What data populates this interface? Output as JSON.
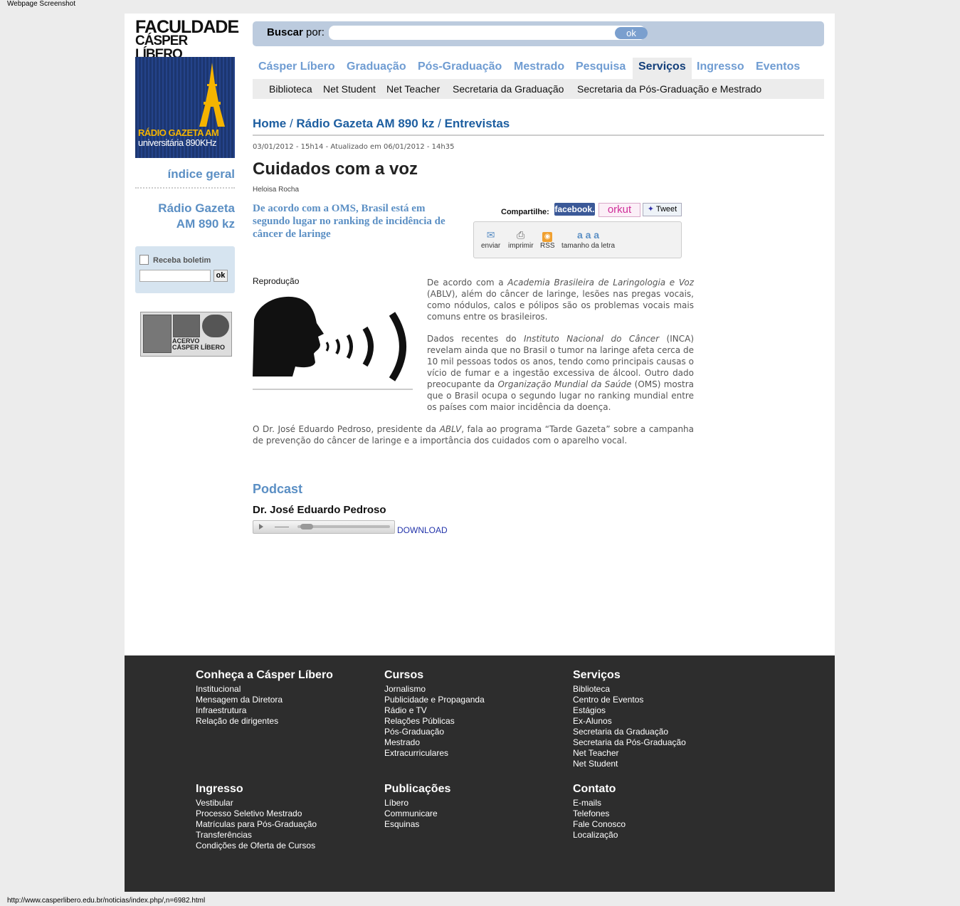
{
  "caption_top": "Webpage Screenshot",
  "caption_bottom": "http://www.casperlibero.edu.br/noticias/index.php/,n=6982.html",
  "logo": {
    "line1": "FACULDADE",
    "line2": "CÁSPER LÍBERO"
  },
  "radio_banner": {
    "line1": "RÁDIO GAZETA AM",
    "line2": "universitária 890KHz"
  },
  "sidebar": {
    "indice": "índice geral",
    "radio_line1": "Rádio Gazeta",
    "radio_line2": "AM 890 kz",
    "boletim_label": "Receba boletim",
    "boletim_ok": "ok",
    "acervo_line1": "ACERVO",
    "acervo_line2": "CÁSPER LÍBERO"
  },
  "search": {
    "label_bold": "Buscar",
    "label": " por:",
    "ok": "ok"
  },
  "nav": [
    "Cásper Líbero",
    "Graduação",
    "Pós-Graduação",
    "Mestrado",
    "Pesquisa",
    "Serviços",
    "Ingresso",
    "Eventos"
  ],
  "subnav": [
    "Biblioteca",
    "Net Student",
    "Net Teacher",
    "Secretaria da Graduação",
    "Secretaria da Pós-Graduação e Mestrado"
  ],
  "breadcrumb": {
    "home": "Home",
    "sep": " / ",
    "section": "Rádio Gazeta AM 890 kz",
    "page": "Entrevistas"
  },
  "article": {
    "date": "03/01/2012 - 15h14 - Atualizado em 06/01/2012 - 14h35",
    "title": "Cuidados com a voz",
    "author": "Heloisa Rocha",
    "lead": "De acordo com a OMS, Brasil está em segundo lugar no ranking de incidência de câncer de laringe",
    "share_label": "Compartilhe:",
    "facebook": "facebook.",
    "orkut": "orkut",
    "tweet": "Tweet",
    "tools": {
      "enviar": "enviar",
      "imprimir": "imprimir",
      "rss": "RSS",
      "tamanho": "tamanho da letra",
      "aaa": "a a a"
    },
    "image_caption": "Reprodução",
    "p1_a": "De acordo com a ",
    "p1_i": "Academia Brasileira de Laringologia e Voz",
    "p1_b": " (ABLV), além do câncer de laringe, lesões nas pregas vocais, como nódulos, calos e pólipos são os problemas vocais mais comuns entre os brasileiros.",
    "p2_a": "Dados recentes do ",
    "p2_i": "Instituto Nacional do Câncer",
    "p2_b": " (INCA) revelam ainda que no Brasil o tumor na laringe afeta cerca de 10 mil pessoas todos os anos, tendo como principais causas o vício de fumar e a ingestão excessiva de álcool. Outro dado preocupante da ",
    "p2_i2": "Organização Mundial da Saúde",
    "p2_c": " (OMS) mostra que o Brasil ocupa o segundo lugar no ranking mundial entre os países com maior incidência da doença.",
    "p3_a": "O Dr. José Eduardo Pedroso, presidente da ",
    "p3_i": "ABLV",
    "p3_b": ", fala ao programa “Tarde Gazeta” sobre a campanha de prevenção do câncer de laringe e a importância dos cuidados com o aparelho vocal.",
    "podcast_heading": "Podcast",
    "podcast_name": "Dr. José Eduardo Pedroso",
    "download": "DOWNLOAD"
  },
  "footer": {
    "conheca": {
      "title": "Conheça a Cásper Líbero",
      "items": [
        "Institucional",
        "Mensagem da Diretora",
        "Infraestrutura",
        "Relação de dirigentes"
      ]
    },
    "cursos": {
      "title": "Cursos",
      "items": [
        "Jornalismo",
        "Publicidade e Propaganda",
        "Rádio e TV",
        "Relações Públicas",
        "Pós-Graduação",
        "Mestrado",
        "Extracurriculares"
      ]
    },
    "servicos": {
      "title": "Serviços",
      "items": [
        "Biblioteca",
        "Centro de Eventos",
        "Estágios",
        "Ex-Alunos",
        "Secretaria da Graduação",
        "Secretaria da Pós-Graduação",
        "Net Teacher",
        "Net Student"
      ]
    },
    "ingresso": {
      "title": "Ingresso",
      "items": [
        "Vestibular",
        "Processo Seletivo Mestrado",
        "Matrículas para Pós-Graduação",
        "Transferências",
        "Condições de Oferta de Cursos"
      ]
    },
    "publicacoes": {
      "title": "Publicações",
      "items": [
        "Líbero",
        "Communicare",
        "Esquinas"
      ]
    },
    "contato": {
      "title": "Contato",
      "items": [
        "E-mails",
        "Telefones",
        "Fale Conosco",
        "Localização"
      ]
    }
  }
}
